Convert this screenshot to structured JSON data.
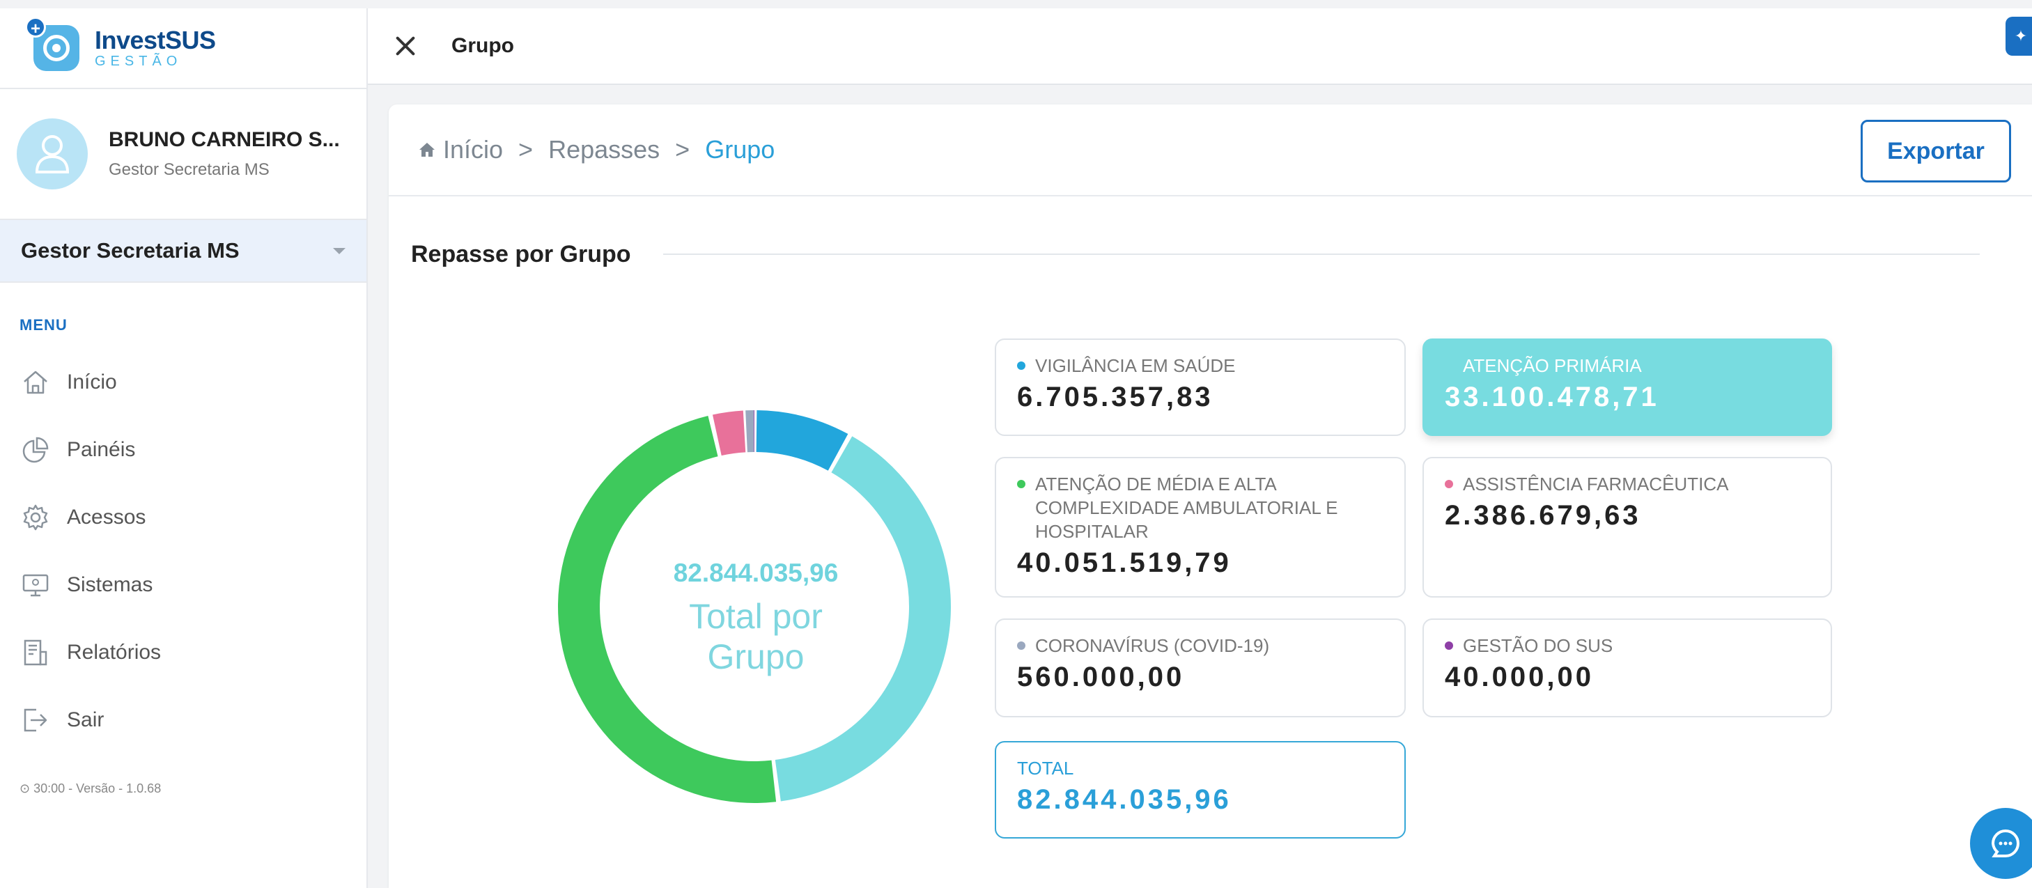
{
  "colors": {
    "accent": "#1a6fc2",
    "breadcrumb_active": "#2a9fd8",
    "donut_center": "#6fd3dd"
  },
  "app": {
    "logo_title": "InvestSUS",
    "logo_sub": "GESTÃO"
  },
  "user": {
    "name": "BRUNO CARNEIRO S...",
    "role": "Gestor Secretaria MS"
  },
  "profile_select": {
    "value": "Gestor Secretaria MS"
  },
  "menu": {
    "title": "MENU",
    "items": [
      {
        "label": "Início",
        "icon": "home-icon"
      },
      {
        "label": "Painéis",
        "icon": "pie-chart-icon"
      },
      {
        "label": "Acessos",
        "icon": "gear-icon"
      },
      {
        "label": "Sistemas",
        "icon": "monitor-icon"
      },
      {
        "label": "Relatórios",
        "icon": "report-icon"
      },
      {
        "label": "Sair",
        "icon": "logout-icon"
      }
    ],
    "version": "⊙ 30:00 - Versão - 1.0.68"
  },
  "topbar": {
    "title": "Grupo"
  },
  "breadcrumb": {
    "items": [
      "Início",
      "Repasses",
      "Grupo"
    ],
    "separator": ">"
  },
  "export_label": "Exportar",
  "section": {
    "title": "Repasse por Grupo"
  },
  "donut": {
    "value": "82.844.035,96",
    "label": "Total por Grupo"
  },
  "tiles": [
    {
      "name": "VIGILÂNCIA EM SAÚDE",
      "value": "6.705.357,83",
      "dot": "#22a6dc"
    },
    {
      "name": "ATENÇÃO PRIMÁRIA",
      "value": "33.100.478,71",
      "dot": "#78dce0"
    },
    {
      "name": "ATENÇÃO DE MÉDIA E ALTA COMPLEXIDADE AMBULATORIAL E HOSPITALAR",
      "value": "40.051.519,79",
      "dot": "#3ec95c"
    },
    {
      "name": "ASSISTÊNCIA FARMACÊUTICA",
      "value": "2.386.679,63",
      "dot": "#e8719a"
    },
    {
      "name": "CORONAVÍRUS (COVID-19)",
      "value": "560.000,00",
      "dot": "#9aa8bf"
    },
    {
      "name": "GESTÃO DO SUS",
      "value": "40.000,00",
      "dot": "#8e3fa6"
    }
  ],
  "total": {
    "label": "TOTAL",
    "value": "82.844.035,96"
  },
  "chart_data": {
    "type": "pie",
    "categories": [
      "VIGILÂNCIA EM SAÚDE",
      "ATENÇÃO PRIMÁRIA",
      "ATENÇÃO DE MÉDIA E ALTA COMPLEXIDADE AMBULATORIAL E HOSPITALAR",
      "ASSISTÊNCIA FARMACÊUTICA",
      "CORONAVÍRUS (COVID-19)",
      "GESTÃO DO SUS"
    ],
    "values": [
      6705357.83,
      33100478.71,
      40051519.79,
      2386679.63,
      560000.0,
      40000.0
    ],
    "colors": [
      "#22a6dc",
      "#78dce0",
      "#3ec95c",
      "#e8719a",
      "#9aa8bf",
      "#8e3fa6"
    ],
    "title": "",
    "legend": "right"
  }
}
